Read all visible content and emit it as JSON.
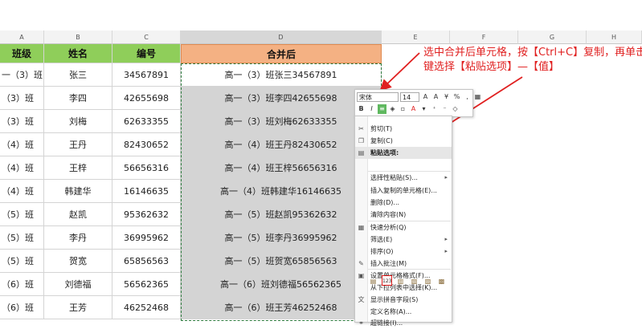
{
  "columns": {
    "letters": [
      "A",
      "B",
      "C",
      "D",
      "E",
      "F",
      "G",
      "H"
    ],
    "selected": "D"
  },
  "table": {
    "headers": {
      "class": "班级",
      "name": "姓名",
      "id": "编号",
      "merged": "合并后"
    },
    "rows": [
      {
        "class": "一（3）班",
        "name": "张三",
        "id": "34567891",
        "merged": "高一（3）班张三34567891"
      },
      {
        "class": "（3）班",
        "name": "李四",
        "id": "42655698",
        "merged": "高一（3）班李四42655698"
      },
      {
        "class": "（3）班",
        "name": "刘梅",
        "id": "62633355",
        "merged": "高一（3）班刘梅62633355"
      },
      {
        "class": "（4）班",
        "name": "王丹",
        "id": "82430652",
        "merged": "高一（4）班王丹82430652"
      },
      {
        "class": "（4）班",
        "name": "王梓",
        "id": "56656316",
        "merged": "高一（4）班王梓56656316"
      },
      {
        "class": "（4）班",
        "name": "韩建华",
        "id": "16146635",
        "merged": "高一（4）班韩建华16146635"
      },
      {
        "class": "（5）班",
        "name": "赵凯",
        "id": "95362632",
        "merged": "高一（5）班赵凯95362632"
      },
      {
        "class": "（5）班",
        "name": "李丹",
        "id": "36995962",
        "merged": "高一（5）班李丹36995962"
      },
      {
        "class": "（5）班",
        "name": "贺宽",
        "id": "65856563",
        "merged": "高一（5）班贺宽65856563"
      },
      {
        "class": "（6）班",
        "name": "刘德福",
        "id": "56562365",
        "merged": "高一（6）班刘德福56562365"
      },
      {
        "class": "（6）班",
        "name": "王芳",
        "id": "46252468",
        "merged": "高一（6）班王芳46252468"
      }
    ]
  },
  "callout": {
    "line1": "选中合并后单元格，按【Ctrl+C】复制，再单击",
    "line2": "键选择【粘贴选项】—【值】",
    "color": "#e02020"
  },
  "mini_toolbar": {
    "font": "宋体",
    "size": "14",
    "bold": "B",
    "italic": "I",
    "percent": "%"
  },
  "context_menu": {
    "items": [
      {
        "label": "剪切(T)",
        "icon": "scissors-icon"
      },
      {
        "label": "复制(C)",
        "icon": "copy-icon"
      },
      {
        "label": "粘贴选项:",
        "icon": "clipboard-icon"
      },
      {
        "label": "选择性粘贴(S)...",
        "icon": ""
      },
      {
        "label": "插入复制的单元格(E)...",
        "icon": ""
      },
      {
        "label": "删除(D)...",
        "icon": ""
      },
      {
        "label": "清除内容(N)",
        "icon": ""
      },
      {
        "label": "快速分析(Q)",
        "icon": "quick-analysis-icon"
      },
      {
        "label": "筛选(E)",
        "icon": ""
      },
      {
        "label": "排序(O)",
        "icon": ""
      },
      {
        "label": "插入批注(M)",
        "icon": "comment-icon"
      },
      {
        "label": "设置单元格格式(F)...",
        "icon": "format-cells-icon"
      },
      {
        "label": "从下拉列表中选择(K)...",
        "icon": ""
      },
      {
        "label": "显示拼音字段(S)",
        "icon": "pinyin-icon"
      },
      {
        "label": "定义名称(A)...",
        "icon": ""
      },
      {
        "label": "超链接(I)...",
        "icon": "link-icon"
      }
    ],
    "paste_value_label": "123"
  }
}
